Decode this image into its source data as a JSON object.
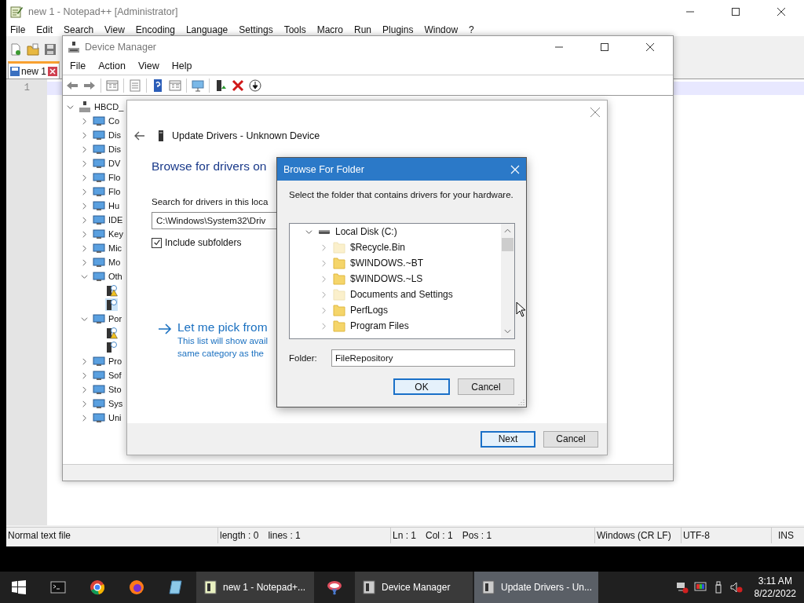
{
  "notepad": {
    "title": "new 1 - Notepad++ [Administrator]",
    "menu": [
      "File",
      "Edit",
      "Search",
      "View",
      "Encoding",
      "Language",
      "Settings",
      "Tools",
      "Macro",
      "Run",
      "Plugins",
      "Window",
      "?"
    ],
    "tabs": [
      {
        "label": "new 1",
        "selected": true
      }
    ],
    "line_numbers": [
      "1"
    ],
    "status_bar": [
      [
        "Normal text file"
      ],
      [
        "length : 0",
        "lines : 1"
      ],
      [
        "Ln : 1",
        "Col : 1",
        "Pos : 1"
      ],
      [
        "Windows (CR LF)"
      ],
      [
        "UTF-8"
      ],
      [
        "INS"
      ]
    ]
  },
  "device_manager": {
    "title": "Device Manager",
    "menu": [
      "File",
      "Action",
      "View",
      "Help"
    ],
    "tree": {
      "label": "HBCD_",
      "expanded": true,
      "selected": false,
      "children": [
        {
          "label": "Co",
          "expanded": false,
          "selected": false
        },
        {
          "label": "Dis",
          "expanded": false,
          "selected": false
        },
        {
          "label": "Dis",
          "expanded": false,
          "selected": false
        },
        {
          "label": "DV",
          "expanded": false,
          "selected": false
        },
        {
          "label": "Flo",
          "expanded": false,
          "selected": false
        },
        {
          "label": "Flo",
          "expanded": false,
          "selected": false
        },
        {
          "label": "Hu",
          "expanded": false,
          "selected": false
        },
        {
          "label": "IDE",
          "expanded": false,
          "selected": false
        },
        {
          "label": "Key",
          "expanded": false,
          "selected": false
        },
        {
          "label": "Mic",
          "expanded": false,
          "selected": false
        },
        {
          "label": "Mo",
          "expanded": false,
          "selected": false
        },
        {
          "label": "Oth",
          "expanded": true,
          "selected": false,
          "children": [
            {
              "warning": true,
              "selected": false
            },
            {
              "warning": false,
              "selected": true
            }
          ]
        },
        {
          "label": "Por",
          "expanded": true,
          "selected": false,
          "children": [
            {
              "warning": true,
              "selected": false
            },
            {
              "warning": false,
              "selected": false
            }
          ]
        },
        {
          "label": "Pro",
          "expanded": false,
          "selected": false
        },
        {
          "label": "Sof",
          "expanded": false,
          "selected": false
        },
        {
          "label": "Sto",
          "expanded": false,
          "selected": false
        },
        {
          "label": "Sys",
          "expanded": false,
          "selected": false
        },
        {
          "label": "Uni",
          "expanded": false,
          "selected": false
        }
      ]
    }
  },
  "update_drivers": {
    "title": "Update Drivers - Unknown Device",
    "heading": "Browse for drivers on",
    "location_label": "Search for drivers in this loca",
    "location": "C:\\Windows\\System32\\Driv",
    "include_subfolders": {
      "label": "Include subfolders",
      "checked": true
    },
    "pick_link": "Let me pick from",
    "pick_description": [
      "This list will show avail",
      "same category as the"
    ],
    "buttons": [
      {
        "label": "Next",
        "default": true
      },
      {
        "label": "Cancel",
        "default": false
      }
    ]
  },
  "browse_folder": {
    "title": "Browse For Folder",
    "prompt": "Select the folder that contains drivers for your hardware.",
    "tree": {
      "label": "Local Disk (C:)",
      "expanded": true,
      "selected": false,
      "children": [
        {
          "label": "$Recycle.Bin",
          "hidden": true,
          "expanded": false,
          "selected": false
        },
        {
          "label": "$WINDOWS.~BT",
          "hidden": false,
          "expanded": false,
          "selected": false
        },
        {
          "label": "$WINDOWS.~LS",
          "hidden": false,
          "expanded": false,
          "selected": false
        },
        {
          "label": "Documents and Settings",
          "hidden": true,
          "expanded": false,
          "selected": false
        },
        {
          "label": "PerfLogs",
          "hidden": false,
          "expanded": false,
          "selected": false
        },
        {
          "label": "Program Files",
          "hidden": false,
          "expanded": false,
          "selected": false
        }
      ]
    },
    "folder_label": "Folder:",
    "folder": "FileRepository",
    "buttons": [
      {
        "label": "OK",
        "default": true
      },
      {
        "label": "Cancel",
        "default": false
      }
    ]
  },
  "taskbar": {
    "windows": [
      {
        "label": "new 1 - Notepad+...",
        "selected": false
      },
      {
        "label": "Device Manager",
        "selected": false
      },
      {
        "label": "Update Drivers - Un...",
        "selected": true
      }
    ],
    "clock": {
      "time": "3:11 AM",
      "date": "8/22/2022"
    }
  }
}
